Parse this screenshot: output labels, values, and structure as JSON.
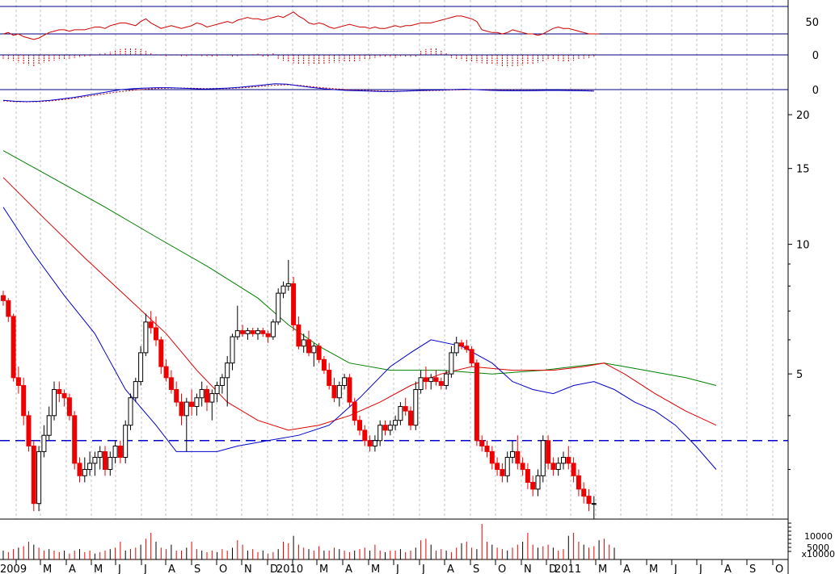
{
  "chart_data": {
    "type": "candlestick",
    "price_axis": {
      "scale": "log",
      "range": [
        2.3,
        22
      ],
      "ticks": [
        {
          "v": 20,
          "label": "20"
        },
        {
          "v": 15,
          "label": "15"
        },
        {
          "v": 10,
          "label": "10"
        },
        {
          "v": 5,
          "label": "5"
        }
      ],
      "reference_level": 3.5
    },
    "indicator_labels": [
      "50",
      "0",
      "0"
    ],
    "volume_labels": [
      "10000",
      "5000",
      "x10000"
    ],
    "x_labels": [
      "2009",
      "M",
      "A",
      "M",
      "J",
      "J",
      "A",
      "S",
      "O",
      "N",
      "D",
      "2010",
      "M",
      "A",
      "M",
      "J",
      "J",
      "A",
      "S",
      "O",
      "N",
      "D",
      "2011",
      "M",
      "A",
      "M",
      "J",
      "J",
      "A",
      "S",
      "O"
    ],
    "candles": [
      [
        7.6,
        7.8,
        7.2,
        7.4
      ],
      [
        7.4,
        7.5,
        6.6,
        6.8
      ],
      [
        6.8,
        6.9,
        4.8,
        4.9
      ],
      [
        4.9,
        5.2,
        4.5,
        4.7
      ],
      [
        4.7,
        4.9,
        3.8,
        4.0
      ],
      [
        4.0,
        4.1,
        3.3,
        3.4
      ],
      [
        3.4,
        3.5,
        2.4,
        2.5
      ],
      [
        2.5,
        3.4,
        2.4,
        3.3
      ],
      [
        3.3,
        3.8,
        3.2,
        3.6
      ],
      [
        3.6,
        4.2,
        3.5,
        4.0
      ],
      [
        4.0,
        4.8,
        3.9,
        4.6
      ],
      [
        4.6,
        4.8,
        4.3,
        4.5
      ],
      [
        4.5,
        4.6,
        4.2,
        4.4
      ],
      [
        4.4,
        4.5,
        3.9,
        4.0
      ],
      [
        4.0,
        4.1,
        3.0,
        3.1
      ],
      [
        3.1,
        3.2,
        2.8,
        2.9
      ],
      [
        2.9,
        3.2,
        2.8,
        3.0
      ],
      [
        3.0,
        3.3,
        2.9,
        3.1
      ],
      [
        3.1,
        3.3,
        2.9,
        3.2
      ],
      [
        3.2,
        3.4,
        3.0,
        3.3
      ],
      [
        3.3,
        3.4,
        2.9,
        3.0
      ],
      [
        3.0,
        3.3,
        2.9,
        3.2
      ],
      [
        3.2,
        3.5,
        3.1,
        3.4
      ],
      [
        3.4,
        3.5,
        3.1,
        3.2
      ],
      [
        3.2,
        3.9,
        3.1,
        3.8
      ],
      [
        3.8,
        4.5,
        3.7,
        4.4
      ],
      [
        4.4,
        4.9,
        4.3,
        4.8
      ],
      [
        4.8,
        5.8,
        4.7,
        5.6
      ],
      [
        5.6,
        6.9,
        5.5,
        6.6
      ],
      [
        6.6,
        7.0,
        6.2,
        6.4
      ],
      [
        6.4,
        6.8,
        5.8,
        6.0
      ],
      [
        6.0,
        6.1,
        5.0,
        5.2
      ],
      [
        5.2,
        5.4,
        4.8,
        4.9
      ],
      [
        4.9,
        5.1,
        4.5,
        4.6
      ],
      [
        4.6,
        4.8,
        4.2,
        4.3
      ],
      [
        4.3,
        4.5,
        3.8,
        4.0
      ],
      [
        4.0,
        4.4,
        3.3,
        4.3
      ],
      [
        4.3,
        4.6,
        4.0,
        4.2
      ],
      [
        4.2,
        4.5,
        4.0,
        4.4
      ],
      [
        4.4,
        4.8,
        4.2,
        4.6
      ],
      [
        4.6,
        4.7,
        4.1,
        4.3
      ],
      [
        4.3,
        4.6,
        3.9,
        4.5
      ],
      [
        4.5,
        4.8,
        4.3,
        4.7
      ],
      [
        4.7,
        5.0,
        4.5,
        4.9
      ],
      [
        4.9,
        5.5,
        4.2,
        5.3
      ],
      [
        5.3,
        6.2,
        5.1,
        6.1
      ],
      [
        6.1,
        7.2,
        6.0,
        6.3
      ],
      [
        6.3,
        6.5,
        6.1,
        6.2
      ],
      [
        6.2,
        6.4,
        6.0,
        6.3
      ],
      [
        6.3,
        6.4,
        6.1,
        6.2
      ],
      [
        6.2,
        6.4,
        6.0,
        6.3
      ],
      [
        6.3,
        6.4,
        6.1,
        6.2
      ],
      [
        6.2,
        6.3,
        5.9,
        6.1
      ],
      [
        6.1,
        6.7,
        6.0,
        6.6
      ],
      [
        6.6,
        7.9,
        6.5,
        7.7
      ],
      [
        7.7,
        8.2,
        7.5,
        8.0
      ],
      [
        8.0,
        9.2,
        7.8,
        8.1
      ],
      [
        8.1,
        8.4,
        6.3,
        6.5
      ],
      [
        6.5,
        6.8,
        5.7,
        5.8
      ],
      [
        5.8,
        6.2,
        5.6,
        6.0
      ],
      [
        6.0,
        6.3,
        5.5,
        5.6
      ],
      [
        5.6,
        5.9,
        5.2,
        5.8
      ],
      [
        5.8,
        5.9,
        5.3,
        5.4
      ],
      [
        5.4,
        5.5,
        5.0,
        5.1
      ],
      [
        5.1,
        5.3,
        4.6,
        4.7
      ],
      [
        4.7,
        4.9,
        4.3,
        4.4
      ],
      [
        4.4,
        4.8,
        4.2,
        4.7
      ],
      [
        4.7,
        5.0,
        4.6,
        4.9
      ],
      [
        4.9,
        5.0,
        4.2,
        4.3
      ],
      [
        4.3,
        4.4,
        3.8,
        3.9
      ],
      [
        3.9,
        4.0,
        3.6,
        3.7
      ],
      [
        3.7,
        3.8,
        3.4,
        3.5
      ],
      [
        3.5,
        3.6,
        3.3,
        3.4
      ],
      [
        3.4,
        3.6,
        3.3,
        3.5
      ],
      [
        3.5,
        3.9,
        3.4,
        3.8
      ],
      [
        3.8,
        3.9,
        3.6,
        3.7
      ],
      [
        3.7,
        3.9,
        3.6,
        3.8
      ],
      [
        3.8,
        4.0,
        3.7,
        3.9
      ],
      [
        3.9,
        4.3,
        3.8,
        4.2
      ],
      [
        4.2,
        4.4,
        4.0,
        4.1
      ],
      [
        4.1,
        4.2,
        3.7,
        3.8
      ],
      [
        3.8,
        4.8,
        3.7,
        4.6
      ],
      [
        4.6,
        5.1,
        4.5,
        4.9
      ],
      [
        4.9,
        5.2,
        4.6,
        4.8
      ],
      [
        4.8,
        5.0,
        4.6,
        4.9
      ],
      [
        4.9,
        5.1,
        4.7,
        4.8
      ],
      [
        4.8,
        4.9,
        4.6,
        4.7
      ],
      [
        4.7,
        5.1,
        4.6,
        5.0
      ],
      [
        5.0,
        5.8,
        4.9,
        5.6
      ],
      [
        5.6,
        6.1,
        5.5,
        5.9
      ],
      [
        5.9,
        6.0,
        5.7,
        5.8
      ],
      [
        5.8,
        6.0,
        5.6,
        5.7
      ],
      [
        5.7,
        5.8,
        5.2,
        5.3
      ],
      [
        5.3,
        5.4,
        3.4,
        3.5
      ],
      [
        3.5,
        3.6,
        3.3,
        3.4
      ],
      [
        3.4,
        3.5,
        3.2,
        3.3
      ],
      [
        3.3,
        3.4,
        3.0,
        3.1
      ],
      [
        3.1,
        3.2,
        2.9,
        3.0
      ],
      [
        3.0,
        3.1,
        2.8,
        2.9
      ],
      [
        2.9,
        3.3,
        2.8,
        3.2
      ],
      [
        3.2,
        3.5,
        3.1,
        3.3
      ],
      [
        3.3,
        3.6,
        3.0,
        3.1
      ],
      [
        3.1,
        3.2,
        2.9,
        3.0
      ],
      [
        3.0,
        3.1,
        2.7,
        2.8
      ],
      [
        2.8,
        2.9,
        2.6,
        2.7
      ],
      [
        2.7,
        3.0,
        2.6,
        2.9
      ],
      [
        2.9,
        3.6,
        2.8,
        3.5
      ],
      [
        3.5,
        3.6,
        3.0,
        3.1
      ],
      [
        3.1,
        3.2,
        2.9,
        3.0
      ],
      [
        3.0,
        3.2,
        2.9,
        3.1
      ],
      [
        3.1,
        3.3,
        3.0,
        3.2
      ],
      [
        3.2,
        3.4,
        3.0,
        3.1
      ],
      [
        3.1,
        3.2,
        2.8,
        2.9
      ],
      [
        2.9,
        3.0,
        2.6,
        2.7
      ],
      [
        2.7,
        2.8,
        2.5,
        2.6
      ],
      [
        2.6,
        2.7,
        2.4,
        2.5
      ],
      [
        2.5,
        2.6,
        2.3,
        2.5
      ]
    ],
    "ma_blue": [
      [
        0,
        12.2
      ],
      [
        6,
        9.5
      ],
      [
        12,
        7.6
      ],
      [
        18,
        6.2
      ],
      [
        24,
        4.6
      ],
      [
        30,
        3.8
      ],
      [
        34,
        3.3
      ],
      [
        38,
        3.3
      ],
      [
        42,
        3.3
      ],
      [
        46,
        3.4
      ],
      [
        52,
        3.5
      ],
      [
        58,
        3.6
      ],
      [
        64,
        3.8
      ],
      [
        70,
        4.4
      ],
      [
        76,
        5.2
      ],
      [
        80,
        5.6
      ],
      [
        84,
        6.0
      ],
      [
        90,
        5.8
      ],
      [
        96,
        5.3
      ],
      [
        100,
        4.8
      ],
      [
        104,
        4.6
      ],
      [
        108,
        4.5
      ],
      [
        112,
        4.7
      ],
      [
        116,
        4.8
      ],
      [
        120,
        4.6
      ],
      [
        124,
        4.3
      ],
      [
        128,
        4.1
      ],
      [
        132,
        3.8
      ],
      [
        136,
        3.4
      ],
      [
        140,
        3.0
      ]
    ],
    "ma_red": [
      [
        0,
        14.3
      ],
      [
        8,
        11.5
      ],
      [
        16,
        9.3
      ],
      [
        24,
        7.6
      ],
      [
        32,
        6.2
      ],
      [
        38,
        5.1
      ],
      [
        44,
        4.3
      ],
      [
        50,
        3.9
      ],
      [
        56,
        3.7
      ],
      [
        62,
        3.8
      ],
      [
        68,
        4.0
      ],
      [
        74,
        4.3
      ],
      [
        80,
        4.7
      ],
      [
        86,
        5.0
      ],
      [
        92,
        5.2
      ],
      [
        100,
        5.1
      ],
      [
        108,
        5.1
      ],
      [
        114,
        5.2
      ],
      [
        118,
        5.3
      ],
      [
        122,
        5.0
      ],
      [
        128,
        4.5
      ],
      [
        134,
        4.1
      ],
      [
        140,
        3.8
      ]
    ],
    "ma_green": [
      [
        0,
        16.5
      ],
      [
        10,
        14.2
      ],
      [
        20,
        12.2
      ],
      [
        30,
        10.4
      ],
      [
        40,
        8.9
      ],
      [
        50,
        7.5
      ],
      [
        56,
        6.5
      ],
      [
        62,
        5.8
      ],
      [
        68,
        5.3
      ],
      [
        76,
        5.1
      ],
      [
        86,
        5.1
      ],
      [
        96,
        5.0
      ],
      [
        106,
        5.1
      ],
      [
        112,
        5.2
      ],
      [
        118,
        5.3
      ],
      [
        126,
        5.1
      ],
      [
        134,
        4.9
      ],
      [
        140,
        4.7
      ]
    ],
    "rsi": [
      50,
      51,
      49,
      50,
      48,
      47,
      46,
      47,
      49,
      51,
      52,
      53,
      53,
      52,
      53,
      53,
      53,
      54,
      55,
      55,
      54,
      56,
      57,
      58,
      58,
      57,
      56,
      59,
      61,
      58,
      56,
      54,
      55,
      56,
      55,
      54,
      55,
      56,
      58,
      57,
      55,
      56,
      57,
      58,
      59,
      58,
      60,
      61,
      62,
      61,
      61,
      60,
      61,
      62,
      63,
      62,
      64,
      66,
      63,
      61,
      58,
      57,
      58,
      57,
      55,
      54,
      55,
      56,
      57,
      56,
      55,
      55,
      54,
      55,
      54,
      54,
      55,
      56,
      55,
      56,
      56,
      57,
      58,
      58,
      58,
      59,
      60,
      61,
      62,
      63,
      63,
      62,
      61,
      59,
      53,
      52,
      51,
      51,
      50,
      51,
      53,
      52,
      51,
      50,
      50,
      49,
      50,
      52,
      54,
      55,
      54,
      54,
      53,
      52,
      51,
      50,
      50,
      50
    ],
    "macd_hist": [
      -0.6,
      -0.8,
      -0.9,
      -1.2,
      -1.4,
      -1.6,
      -1.8,
      -1.5,
      -1.2,
      -1.0,
      -0.9,
      -0.8,
      -0.7,
      -0.6,
      -0.5,
      -0.4,
      -0.3,
      -0.2,
      -0.1,
      0.2,
      0.3,
      0.5,
      0.7,
      0.9,
      1.0,
      1.1,
      1.0,
      0.9,
      0.6,
      0.3,
      0.1,
      -0.1,
      -0.2,
      -0.1,
      -0.1,
      -0.2,
      -0.2,
      -0.1,
      -0.1,
      -0.2,
      -0.2,
      -0.3,
      -0.2,
      -0.1,
      -0.1,
      -0.3,
      -0.2,
      -0.1,
      0.1,
      0.1,
      0.2,
      -0.3,
      -0.4,
      0.3,
      -0.6,
      -0.9,
      -1.1,
      -1.3,
      -1.4,
      -1.5,
      -1.6,
      -1.5,
      -1.4,
      -1.4,
      -1.3,
      -1.2,
      -1.2,
      -1.1,
      -1.1,
      -1.0,
      -0.9,
      -0.7,
      -0.6,
      -0.5,
      -0.4,
      -0.3,
      -0.4,
      -0.5,
      -0.2,
      -0.3,
      -0.4,
      -0.3,
      0.6,
      0.9,
      1.1,
      1.0,
      0.7,
      0.3,
      -0.5,
      -0.7,
      -0.8,
      -1.0,
      -1.1,
      -1.2,
      -1.3,
      -1.4,
      -1.5,
      -1.6,
      -1.8,
      -1.9,
      -1.8,
      -1.7,
      -1.6,
      -1.5,
      -1.4,
      -1.2,
      -1.0,
      -0.8,
      -0.7,
      -0.9,
      -1.0,
      -1.1,
      -0.9,
      -0.7,
      -0.6,
      -0.5,
      -0.4
    ],
    "macd_line": [
      -0.55,
      -0.6,
      -0.62,
      -0.6,
      -0.55,
      -0.48,
      -0.4,
      -0.3,
      -0.2,
      -0.1,
      0.0,
      0.05,
      0.08,
      0.1,
      0.1,
      0.08,
      0.05,
      0.03,
      0.05,
      0.08,
      0.12,
      0.18,
      0.24,
      0.3,
      0.28,
      0.2,
      0.12,
      0.05,
      0.0,
      -0.04,
      -0.06,
      -0.08,
      -0.1,
      -0.1,
      -0.08,
      -0.05,
      -0.03,
      -0.02,
      0.0,
      0.02,
      0.0,
      -0.03,
      -0.05,
      -0.06,
      -0.06,
      -0.05,
      -0.04,
      -0.04,
      -0.05,
      -0.06,
      -0.08
    ],
    "macd_signal": [
      -0.58,
      -0.62,
      -0.63,
      -0.62,
      -0.58,
      -0.52,
      -0.45,
      -0.36,
      -0.27,
      -0.18,
      -0.1,
      -0.03,
      0.02,
      0.06,
      0.08,
      0.08,
      0.07,
      0.05,
      0.05,
      0.06,
      0.09,
      0.13,
      0.18,
      0.23,
      0.25,
      0.22,
      0.16,
      0.1,
      0.05,
      0.0,
      -0.03,
      -0.05,
      -0.07,
      -0.08,
      -0.08,
      -0.06,
      -0.05,
      -0.04,
      -0.02,
      0.0,
      0.0,
      -0.01,
      -0.03,
      -0.04,
      -0.05,
      -0.05,
      -0.04,
      -0.04,
      -0.04,
      -0.05,
      -0.06
    ],
    "volume": [
      300,
      250,
      350,
      400,
      450,
      600,
      500,
      400,
      300,
      350,
      300,
      250,
      300,
      200,
      300,
      350,
      250,
      300,
      200,
      250,
      300,
      350,
      400,
      600,
      300,
      350,
      400,
      500,
      700,
      900,
      600,
      400,
      350,
      500,
      300,
      300,
      400,
      600,
      350,
      300,
      250,
      300,
      250,
      350,
      300,
      400,
      650,
      500,
      300,
      350,
      250,
      300,
      200,
      250,
      350,
      600,
      550,
      800,
      500,
      400,
      350,
      300,
      450,
      300,
      300,
      400,
      350,
      300,
      250,
      300,
      350,
      400,
      300,
      500,
      300,
      250,
      300,
      300,
      350,
      250,
      300,
      400,
      650,
      700,
      500,
      300,
      350,
      300,
      250,
      400,
      550,
      600,
      400,
      350,
      1200,
      600,
      500,
      400,
      350,
      300,
      400,
      500,
      600,
      900,
      500,
      400,
      450,
      500,
      400,
      300,
      350,
      800,
      900,
      600,
      500,
      400,
      450,
      650,
      700,
      500,
      400
    ]
  }
}
